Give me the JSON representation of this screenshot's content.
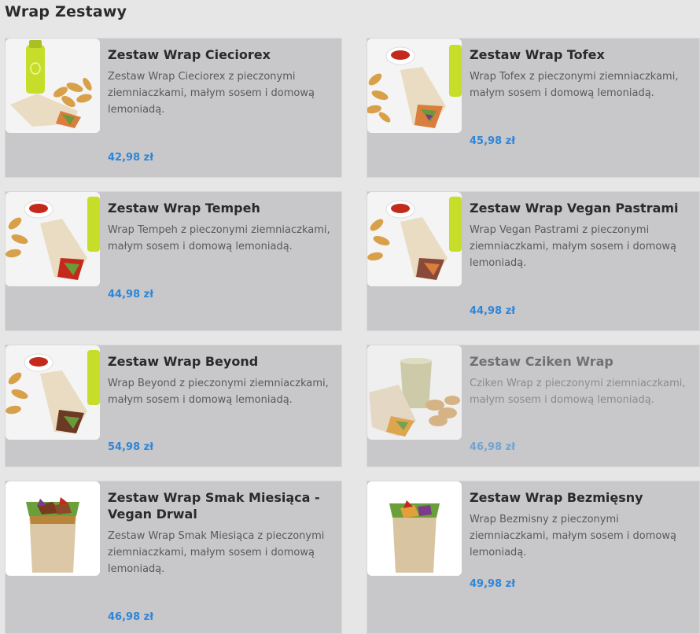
{
  "section": {
    "title": "Wrap Zestawy"
  },
  "colors": {
    "price": "#2f86d6",
    "card_bg": "#c8c7ca",
    "page_bg": "#e6e6e6"
  },
  "products": [
    {
      "name": "Zestaw Wrap Cieciorex",
      "description": "Zestaw Wrap Cieciorex z pieczonymi ziemniaczkami, małym sosem i domową lemoniadą.",
      "price": "42,98 zł",
      "image": "wrap-set-bottle-fries-photo",
      "available": true
    },
    {
      "name": "Zestaw Wrap Tofex",
      "description": "Wrap Tofex z pieczonymi ziemniaczkami, małym sosem i domową lemoniadą.",
      "price": "45,98 zł",
      "image": "wrap-set-sauce-fries-bottle-photo",
      "available": true
    },
    {
      "name": "Zestaw Wrap Tempeh",
      "description": "Wrap Tempeh z pieczonymi ziemniaczkami, małym sosem i domową lemoniadą.",
      "price": "44,98 zł",
      "image": "wrap-set-sauce-fries-bottle-photo",
      "available": true
    },
    {
      "name": "Zestaw Wrap Vegan Pastrami",
      "description": "Wrap Vegan Pastrami z pieczonymi ziemniaczkami, małym sosem i domową lemoniadą.",
      "price": "44,98 zł",
      "image": "wrap-set-sauce-fries-bottle-photo",
      "available": true
    },
    {
      "name": "Zestaw Wrap Beyond",
      "description": "Wrap Beyond z pieczonymi ziemniaczkami, małym sosem i domową lemoniadą.",
      "price": "54,98 zł",
      "image": "wrap-set-sauce-fries-bottle-photo",
      "available": true
    },
    {
      "name": "Zestaw Cziken Wrap",
      "description": "Cziken Wrap z pieczonymi ziemniaczkami, małym sosem i domową lemoniadą.",
      "price": "46,98 zł",
      "image": "wrap-set-glass-fries-photo",
      "available": false
    },
    {
      "name": "Zestaw Wrap Smak Miesiąca - Vegan Drwal",
      "description": "Zestaw Wrap Smak Miesiąca z pieczonymi ziemniaczkami, małym sosem i domową lemoniadą.",
      "price": "46,98 zł",
      "image": "wrap-closeup-photo",
      "available": true
    },
    {
      "name": "Zestaw Wrap Bezmięsny",
      "description": "Wrap Bezmisny z pieczonymi ziemniaczkami, małym sosem i domową lemoniadą.",
      "price": "49,98 zł",
      "image": "wrap-closeup-photo",
      "available": true
    }
  ]
}
